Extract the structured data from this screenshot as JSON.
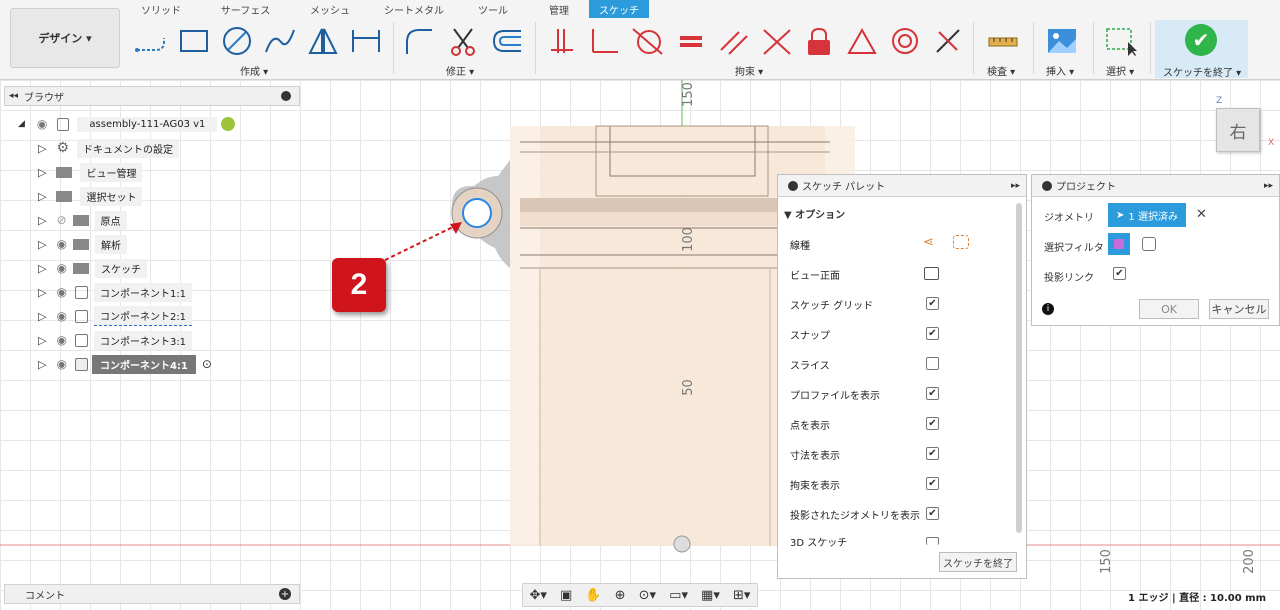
{
  "toolbar": {
    "design_label": "デザイン",
    "tabs": [
      "ソリッド",
      "サーフェス",
      "メッシュ",
      "シートメタル",
      "ツール",
      "管理",
      "スケッチ"
    ],
    "groups": {
      "create": "作成",
      "modify": "修正",
      "constrain": "拘束",
      "inspect": "検査",
      "insert": "挿入",
      "select": "選択",
      "finish": "スケッチを終了"
    }
  },
  "browser": {
    "title": "ブラウザ",
    "root": "assembly-111-AG03 v1",
    "items": [
      {
        "label": "ドキュメントの設定"
      },
      {
        "label": "ビュー管理"
      },
      {
        "label": "選択セット"
      },
      {
        "label": "原点"
      },
      {
        "label": "解析"
      },
      {
        "label": "スケッチ"
      },
      {
        "label": "コンポーネント1:1"
      },
      {
        "label": "コンポーネント2:1"
      },
      {
        "label": "コンポーネント3:1"
      },
      {
        "label": "コンポーネント4:1"
      }
    ]
  },
  "palette": {
    "title": "スケッチ パレット",
    "section": "オプション",
    "rows": [
      {
        "label": "線種"
      },
      {
        "label": "ビュー正面"
      },
      {
        "label": "スケッチ グリッド",
        "checked": "✔"
      },
      {
        "label": "スナップ",
        "checked": "✔"
      },
      {
        "label": "スライス",
        "checked": ""
      },
      {
        "label": "プロファイルを表示",
        "checked": "✔"
      },
      {
        "label": "点を表示",
        "checked": "✔"
      },
      {
        "label": "寸法を表示",
        "checked": "✔"
      },
      {
        "label": "拘束を表示",
        "checked": "✔"
      },
      {
        "label": "投影されたジオメトリを表示",
        "checked": "✔"
      },
      {
        "label": "3D スケッチ",
        "checked": ""
      }
    ],
    "finish_button": "スケッチを終了"
  },
  "project": {
    "title": "プロジェクト",
    "geometry_label": "ジオメトリ",
    "geometry_value": "1 選択済み",
    "filter_label": "選択フィルタ",
    "link_label": "投影リンク",
    "link_checked": "✔",
    "ok": "OK",
    "cancel": "キャンセル"
  },
  "canvas": {
    "ruler": [
      "150",
      "100",
      "50"
    ],
    "ruler_bottom": [
      "150",
      "200"
    ],
    "viewcube_face": "右",
    "axis_z": "Z",
    "axis_x": "X",
    "callout_number": "2"
  },
  "comments": {
    "label": "コメント"
  },
  "status": {
    "text": "1 エッジ | 直径 : 10.00 mm"
  },
  "colors": {
    "accent": "#2b9bdc",
    "finish_green": "#2fb54a",
    "callout": "#d0141c",
    "constraint_red": "#d6333a"
  }
}
